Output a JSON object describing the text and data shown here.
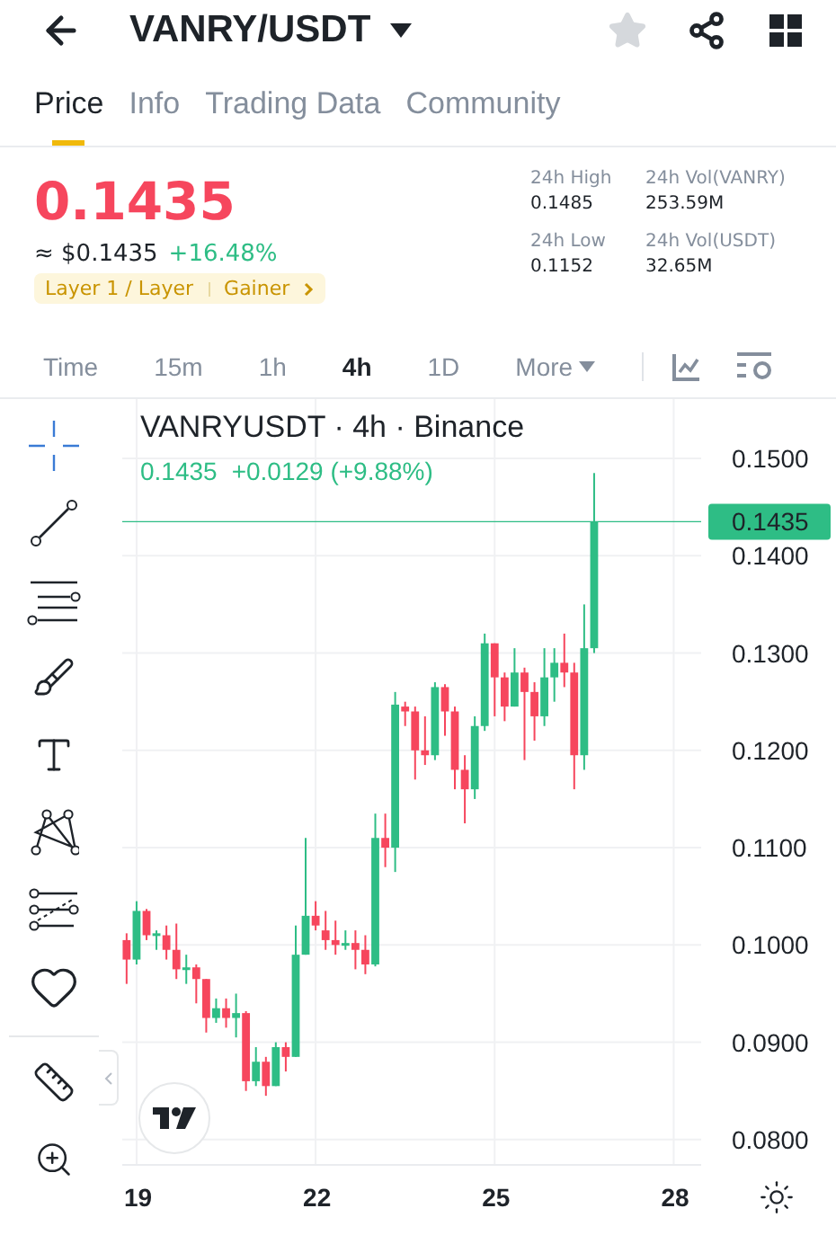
{
  "header": {
    "title": "VANRY/USDT",
    "favorite": false
  },
  "tabs": [
    {
      "label": "Price",
      "selected": true
    },
    {
      "label": "Info",
      "selected": false
    },
    {
      "label": "Trading Data",
      "selected": false
    },
    {
      "label": "Community",
      "selected": false
    }
  ],
  "price": {
    "last": "0.1435",
    "fiat": "≈ $0.1435",
    "change": "+16.48%",
    "tags": [
      "Layer 1 / Layer",
      "Gainer"
    ]
  },
  "stats": [
    {
      "label": "24h High",
      "value": "0.1485"
    },
    {
      "label": "24h Vol(VANRY)",
      "value": "253.59M"
    },
    {
      "label": "24h Low",
      "value": "0.1152"
    },
    {
      "label": "24h Vol(USDT)",
      "value": "32.65M"
    }
  ],
  "intervals": [
    {
      "label": "Time",
      "kind": "option",
      "selected": false
    },
    {
      "label": "15m",
      "kind": "option",
      "selected": false
    },
    {
      "label": "1h",
      "kind": "option",
      "selected": false
    },
    {
      "label": "4h",
      "kind": "option",
      "selected": true
    },
    {
      "label": "1D",
      "kind": "option",
      "selected": false
    },
    {
      "label": "More",
      "kind": "menu",
      "selected": false
    }
  ],
  "chart": {
    "title": "VANRYUSDT · 4h · Binance",
    "quote": "0.1435",
    "change": "+0.0129 (+9.88%)",
    "chart_data": {
      "type": "candlestick",
      "grid": true,
      "xlim": [
        18.76,
        28.46
      ],
      "xticks": [
        19,
        22,
        25,
        28
      ],
      "ylim": [
        0.0774,
        0.1561
      ],
      "ref_lines": [
        {
          "axis": "y",
          "value": 0.1435,
          "color": "#2ebd85",
          "label": "0.1435"
        }
      ],
      "x": [
        18.833,
        19,
        19.167,
        19.333,
        19.5,
        19.667,
        19.833,
        20,
        20.167,
        20.333,
        20.5,
        20.667,
        20.833,
        21,
        21.167,
        21.333,
        21.5,
        21.667,
        21.833,
        22,
        22.167,
        22.333,
        22.5,
        22.667,
        22.833,
        23,
        23.167,
        23.333,
        23.5,
        23.667,
        23.833,
        24,
        24.167,
        24.333,
        24.5,
        24.667,
        24.833,
        25,
        25.167,
        25.333,
        25.5,
        25.667,
        25.833,
        26,
        26.167,
        26.333,
        26.5,
        26.667
      ],
      "yticks": [
        {
          "value": 0.15,
          "label": "0.1500"
        },
        {
          "value": 0.14,
          "label": "0.1400"
        },
        {
          "value": 0.13,
          "label": "0.1300"
        },
        {
          "value": 0.12,
          "label": "0.1200"
        },
        {
          "value": 0.11,
          "label": "0.1100"
        },
        {
          "value": 0.1,
          "label": "0.1000"
        },
        {
          "value": 0.09,
          "label": "0.0900"
        },
        {
          "value": 0.08,
          "label": "0.0800"
        }
      ],
      "ohlc": [
        [
          0.1005,
          0.1012,
          0.096,
          0.0985
        ],
        [
          0.0985,
          0.1045,
          0.098,
          0.1035
        ],
        [
          0.1035,
          0.1037,
          0.1005,
          0.101
        ],
        [
          0.101,
          0.1015,
          0.0995,
          0.1012
        ],
        [
          0.101,
          0.102,
          0.0985,
          0.0995
        ],
        [
          0.0995,
          0.1022,
          0.0965,
          0.0975
        ],
        [
          0.0975,
          0.099,
          0.096,
          0.0977
        ],
        [
          0.0977,
          0.098,
          0.094,
          0.0965
        ],
        [
          0.0965,
          0.0965,
          0.091,
          0.0925
        ],
        [
          0.0925,
          0.0945,
          0.092,
          0.0935
        ],
        [
          0.0935,
          0.0945,
          0.0915,
          0.0925
        ],
        [
          0.0925,
          0.095,
          0.0905,
          0.093
        ],
        [
          0.093,
          0.0932,
          0.085,
          0.086
        ],
        [
          0.086,
          0.0895,
          0.0855,
          0.088
        ],
        [
          0.088,
          0.0885,
          0.0845,
          0.0855
        ],
        [
          0.0855,
          0.09,
          0.0855,
          0.0895
        ],
        [
          0.0895,
          0.09,
          0.087,
          0.0885
        ],
        [
          0.0885,
          0.102,
          0.0885,
          0.099
        ],
        [
          0.099,
          0.111,
          0.099,
          0.103
        ],
        [
          0.103,
          0.1045,
          0.1015,
          0.102
        ],
        [
          0.1015,
          0.1035,
          0.0995,
          0.1005
        ],
        [
          0.1005,
          0.1025,
          0.099,
          0.1
        ],
        [
          0.1,
          0.1015,
          0.0995,
          0.1002
        ],
        [
          0.1002,
          0.1015,
          0.0975,
          0.0995
        ],
        [
          0.0995,
          0.101,
          0.097,
          0.098
        ],
        [
          0.098,
          0.1135,
          0.0978,
          0.111
        ],
        [
          0.111,
          0.1135,
          0.108,
          0.11
        ],
        [
          0.11,
          0.126,
          0.1075,
          0.1247
        ],
        [
          0.1245,
          0.125,
          0.1225,
          0.124
        ],
        [
          0.124,
          0.1245,
          0.117,
          0.12
        ],
        [
          0.12,
          0.1235,
          0.1185,
          0.1195
        ],
        [
          0.1195,
          0.127,
          0.119,
          0.1265
        ],
        [
          0.1265,
          0.1268,
          0.1215,
          0.124
        ],
        [
          0.124,
          0.1245,
          0.116,
          0.118
        ],
        [
          0.118,
          0.1195,
          0.1125,
          0.116
        ],
        [
          0.116,
          0.1235,
          0.115,
          0.1225
        ],
        [
          0.1225,
          0.132,
          0.122,
          0.131
        ],
        [
          0.131,
          0.131,
          0.1235,
          0.1275
        ],
        [
          0.1275,
          0.128,
          0.123,
          0.1245
        ],
        [
          0.1245,
          0.1305,
          0.1245,
          0.128
        ],
        [
          0.128,
          0.1285,
          0.119,
          0.126
        ],
        [
          0.126,
          0.127,
          0.121,
          0.1235
        ],
        [
          0.1235,
          0.1305,
          0.1225,
          0.1275
        ],
        [
          0.1275,
          0.1305,
          0.125,
          0.129
        ],
        [
          0.129,
          0.132,
          0.1265,
          0.128
        ],
        [
          0.128,
          0.129,
          0.116,
          0.1195
        ],
        [
          0.1195,
          0.135,
          0.118,
          0.1305
        ],
        [
          0.1305,
          0.1485,
          0.13,
          0.1435
        ]
      ]
    }
  }
}
